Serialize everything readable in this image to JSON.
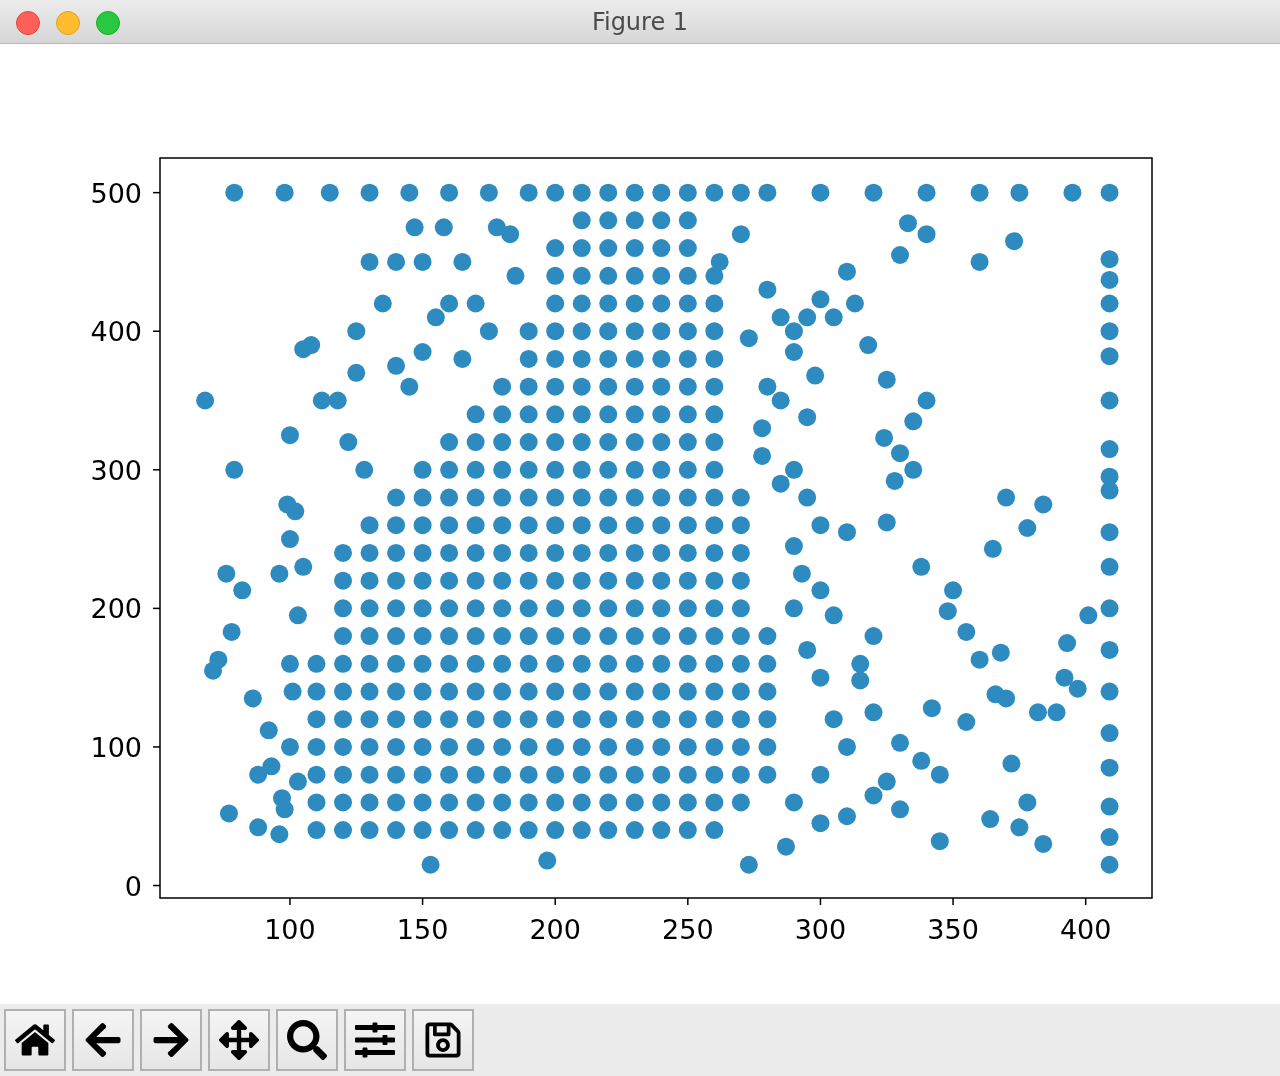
{
  "window": {
    "title": "Figure 1"
  },
  "figure": {
    "chart_data": {
      "type": "scatter",
      "xlim": [
        51,
        425
      ],
      "ylim": [
        -9,
        525
      ],
      "xticks": [
        100,
        150,
        200,
        250,
        300,
        350,
        400
      ],
      "yticks": [
        0,
        100,
        200,
        300,
        400,
        500
      ],
      "series": [
        {
          "color": "#2e8bc0",
          "x": [
            110,
            120,
            130,
            140,
            150,
            160,
            170,
            180,
            190,
            200,
            210,
            220,
            230,
            240,
            250,
            260,
            110,
            120,
            130,
            140,
            150,
            160,
            170,
            180,
            190,
            200,
            210,
            220,
            230,
            240,
            250,
            260,
            270,
            110,
            120,
            130,
            140,
            150,
            160,
            170,
            180,
            190,
            200,
            210,
            220,
            230,
            240,
            250,
            260,
            270,
            280,
            110,
            120,
            130,
            140,
            150,
            160,
            170,
            180,
            190,
            200,
            210,
            220,
            230,
            240,
            250,
            260,
            270,
            280,
            110,
            120,
            130,
            140,
            150,
            160,
            170,
            180,
            190,
            200,
            210,
            220,
            230,
            240,
            250,
            260,
            270,
            280,
            110,
            120,
            130,
            140,
            150,
            160,
            170,
            180,
            190,
            200,
            210,
            220,
            230,
            240,
            250,
            260,
            270,
            280,
            110,
            120,
            130,
            140,
            150,
            160,
            170,
            180,
            190,
            200,
            210,
            220,
            230,
            240,
            250,
            260,
            270,
            280,
            120,
            130,
            140,
            150,
            160,
            170,
            180,
            190,
            200,
            210,
            220,
            230,
            240,
            250,
            260,
            270,
            280,
            120,
            130,
            140,
            150,
            160,
            170,
            180,
            190,
            200,
            210,
            220,
            230,
            240,
            250,
            260,
            270,
            120,
            130,
            140,
            150,
            160,
            170,
            180,
            190,
            200,
            210,
            220,
            230,
            240,
            250,
            260,
            270,
            120,
            130,
            140,
            150,
            160,
            170,
            180,
            190,
            200,
            210,
            220,
            230,
            240,
            250,
            260,
            270,
            130,
            140,
            150,
            160,
            170,
            180,
            190,
            200,
            210,
            220,
            230,
            240,
            250,
            260,
            270,
            140,
            150,
            160,
            170,
            180,
            190,
            200,
            210,
            220,
            230,
            240,
            250,
            260,
            270,
            150,
            160,
            170,
            180,
            190,
            200,
            210,
            220,
            230,
            240,
            250,
            260,
            160,
            170,
            180,
            190,
            200,
            210,
            220,
            230,
            240,
            250,
            260,
            170,
            180,
            190,
            200,
            210,
            220,
            230,
            240,
            250,
            260,
            180,
            190,
            200,
            210,
            220,
            230,
            240,
            250,
            260,
            190,
            200,
            210,
            220,
            230,
            240,
            250,
            260,
            190,
            200,
            210,
            220,
            230,
            240,
            250,
            260,
            200,
            210,
            220,
            230,
            240,
            250,
            260,
            200,
            210,
            220,
            230,
            240,
            250,
            260,
            200,
            210,
            220,
            230,
            240,
            250,
            210,
            220,
            230,
            240,
            250,
            190,
            200,
            210,
            220,
            230,
            240,
            250,
            260,
            270,
            280,
            68,
            79,
            76,
            82,
            78,
            73,
            71,
            86,
            92,
            88,
            93,
            77,
            88,
            96,
            97,
            99,
            100,
            100,
            96,
            105,
            79,
            98,
            115,
            130,
            145,
            160,
            175,
            300,
            320,
            340,
            360,
            375,
            395,
            409,
            409,
            409,
            409,
            409,
            409,
            409,
            409,
            409,
            409,
            409,
            409,
            409,
            409,
            409,
            409,
            409,
            409,
            409,
            409,
            153,
            273,
            197,
            287,
            345,
            384,
            375,
            364,
            378,
            372,
            365,
            370,
            384,
            378,
            401,
            393,
            389,
            392,
            397,
            360,
            373,
            340,
            330,
            333,
            310,
            313,
            325,
            340,
            335,
            330,
            328,
            325,
            338,
            350,
            348,
            355,
            360,
            366,
            370,
            368,
            355,
            342,
            345,
            338,
            330,
            320,
            315,
            305,
            300,
            310,
            295,
            298,
            290,
            295,
            300,
            305,
            318,
            335,
            324,
            290,
            295,
            300,
            290,
            293,
            290,
            295,
            300,
            305,
            310,
            300,
            290,
            300,
            310,
            320,
            325,
            330,
            382,
            320,
            315,
            262,
            270,
            280,
            285,
            273,
            290,
            280,
            285,
            278,
            278,
            285,
            102,
            105,
            103,
            100,
            101,
            100,
            98,
            103,
            108,
            112,
            118,
            122,
            125,
            125,
            130,
            135,
            128,
            140,
            147,
            150,
            158,
            165,
            145,
            150,
            140,
            155,
            160,
            170,
            178,
            183,
            185,
            175,
            165
          ],
          "values": [
            40,
            40,
            40,
            40,
            40,
            40,
            40,
            40,
            40,
            40,
            40,
            40,
            40,
            40,
            40,
            40,
            60,
            60,
            60,
            60,
            60,
            60,
            60,
            60,
            60,
            60,
            60,
            60,
            60,
            60,
            60,
            60,
            60,
            80,
            80,
            80,
            80,
            80,
            80,
            80,
            80,
            80,
            80,
            80,
            80,
            80,
            80,
            80,
            80,
            80,
            80,
            100,
            100,
            100,
            100,
            100,
            100,
            100,
            100,
            100,
            100,
            100,
            100,
            100,
            100,
            100,
            100,
            100,
            100,
            120,
            120,
            120,
            120,
            120,
            120,
            120,
            120,
            120,
            120,
            120,
            120,
            120,
            120,
            120,
            120,
            120,
            120,
            140,
            140,
            140,
            140,
            140,
            140,
            140,
            140,
            140,
            140,
            140,
            140,
            140,
            140,
            140,
            140,
            140,
            140,
            160,
            160,
            160,
            160,
            160,
            160,
            160,
            160,
            160,
            160,
            160,
            160,
            160,
            160,
            160,
            160,
            160,
            160,
            180,
            180,
            180,
            180,
            180,
            180,
            180,
            180,
            180,
            180,
            180,
            180,
            180,
            180,
            180,
            180,
            180,
            200,
            200,
            200,
            200,
            200,
            200,
            200,
            200,
            200,
            200,
            200,
            200,
            200,
            200,
            200,
            200,
            220,
            220,
            220,
            220,
            220,
            220,
            220,
            220,
            220,
            220,
            220,
            220,
            220,
            220,
            220,
            220,
            240,
            240,
            240,
            240,
            240,
            240,
            240,
            240,
            240,
            240,
            240,
            240,
            240,
            240,
            240,
            240,
            260,
            260,
            260,
            260,
            260,
            260,
            260,
            260,
            260,
            260,
            260,
            260,
            260,
            260,
            260,
            280,
            280,
            280,
            280,
            280,
            280,
            280,
            280,
            280,
            280,
            280,
            280,
            280,
            280,
            300,
            300,
            300,
            300,
            300,
            300,
            300,
            300,
            300,
            300,
            300,
            300,
            320,
            320,
            320,
            320,
            320,
            320,
            320,
            320,
            320,
            320,
            320,
            340,
            340,
            340,
            340,
            340,
            340,
            340,
            340,
            340,
            340,
            360,
            360,
            360,
            360,
            360,
            360,
            360,
            360,
            360,
            380,
            380,
            380,
            380,
            380,
            380,
            380,
            380,
            400,
            400,
            400,
            400,
            400,
            400,
            400,
            400,
            420,
            420,
            420,
            420,
            420,
            420,
            420,
            440,
            440,
            440,
            440,
            440,
            440,
            440,
            460,
            460,
            460,
            460,
            460,
            460,
            480,
            480,
            480,
            480,
            480,
            500,
            500,
            500,
            500,
            500,
            500,
            500,
            500,
            500,
            500,
            350,
            300,
            225,
            213,
            183,
            163,
            155,
            135,
            112,
            80,
            86,
            52,
            42,
            37,
            63,
            275,
            325,
            250,
            225,
            387,
            500,
            500,
            500,
            500,
            500,
            500,
            500,
            500,
            500,
            500,
            500,
            500,
            500,
            500,
            452,
            437,
            420,
            400,
            382,
            350,
            315,
            295,
            285,
            255,
            230,
            200,
            170,
            140,
            110,
            85,
            57,
            35,
            15,
            15,
            15,
            18,
            28,
            32,
            30,
            42,
            48,
            60,
            88,
            243,
            280,
            275,
            258,
            195,
            175,
            125,
            150,
            142,
            450,
            465,
            470,
            455,
            478,
            443,
            420,
            365,
            350,
            335,
            312,
            292,
            262,
            230,
            213,
            198,
            183,
            163,
            138,
            135,
            168,
            118,
            128,
            80,
            90,
            103,
            125,
            148,
            195,
            213,
            255,
            338,
            368,
            400,
            410,
            423,
            410,
            390,
            300,
            323,
            300,
            280,
            260,
            245,
            225,
            200,
            170,
            150,
            120,
            100,
            80,
            60,
            45,
            50,
            65,
            75,
            55,
            125,
            180,
            160,
            450,
            470,
            430,
            410,
            395,
            385,
            360,
            350,
            330,
            310,
            290,
            270,
            230,
            195,
            160,
            140,
            100,
            55,
            75,
            390,
            350,
            350,
            320,
            400,
            370,
            450,
            420,
            300,
            450,
            475,
            450,
            475,
            450,
            360,
            385,
            375,
            410,
            420,
            420,
            475,
            470,
            440,
            400,
            380
          ]
        }
      ]
    }
  },
  "toolbar": {
    "buttons": [
      {
        "kind": "home"
      },
      {
        "kind": "back"
      },
      {
        "kind": "forward"
      },
      {
        "kind": "pan"
      },
      {
        "kind": "zoom"
      },
      {
        "kind": "configure"
      },
      {
        "kind": "save"
      }
    ]
  }
}
